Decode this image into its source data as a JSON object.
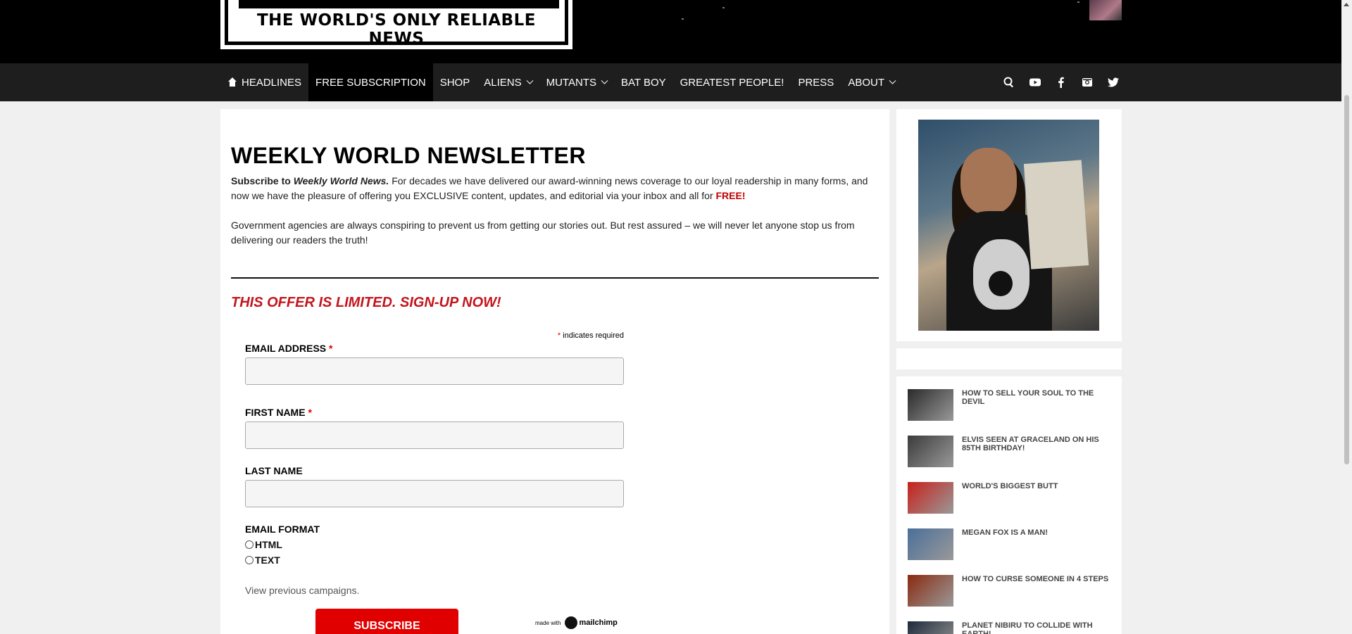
{
  "header": {
    "logo_tagline": "THE WORLD'S ONLY RELIABLE NEWS"
  },
  "nav": {
    "items": [
      {
        "label": "HEADLINES",
        "active": false
      },
      {
        "label": "FREE SUBSCRIPTION",
        "active": true
      },
      {
        "label": "SHOP",
        "active": false
      },
      {
        "label": "ALIENS",
        "active": false
      },
      {
        "label": "MUTANTS",
        "active": false
      },
      {
        "label": "BAT BOY",
        "active": false
      },
      {
        "label": "GREATEST PEOPLE!",
        "active": false
      },
      {
        "label": "PRESS",
        "active": false
      },
      {
        "label": "ABOUT",
        "active": false
      }
    ],
    "icons": [
      "search-icon",
      "youtube-icon",
      "facebook-icon",
      "instagram-icon",
      "twitter-icon"
    ]
  },
  "main": {
    "title": "WEEKLY WORLD NEWSLETTER",
    "intro1_lead": "Subscribe to ",
    "intro1_pub": "Weekly World News.",
    "intro1_body": " For decades we have delivered our award-winning news coverage to our loyal readership in many forms, and now we have the pleasure of offering you EXCLUSIVE content, updates, and editorial via your inbox and all for ",
    "intro1_free": "FREE!",
    "intro2": "Government agencies are always conspiring to prevent us from getting our stories out. But rest assured – we will never let anyone stop us from delivering our readers the truth!",
    "offer": "THIS OFFER IS LIMITED. SIGN-UP NOW!"
  },
  "form": {
    "required_mark": "*",
    "required_note": " indicates required",
    "email_label": "EMAIL ADDRESS ",
    "first_label": "FIRST NAME ",
    "last_label": "LAST NAME",
    "format_label": "EMAIL FORMAT",
    "format_options": [
      "HTML",
      "TEXT"
    ],
    "previous": "View previous campaigns.",
    "subscribe": "SUBSCRIBE",
    "made_with": "made with",
    "mailchimp": "mailchimp"
  },
  "sidebar": {
    "headlines": [
      {
        "title": "HOW TO SELL YOUR SOUL TO THE DEVIL",
        "thumb_color": "#2a2a2a"
      },
      {
        "title": "ELVIS SEEN AT GRACELAND ON HIS 85th BIRTHDAY!",
        "thumb_color": "#3b3b3b"
      },
      {
        "title": "WORLD'S BIGGEST BUTT",
        "thumb_color": "#c8201a"
      },
      {
        "title": "MEGAN FOX IS A MAN!",
        "thumb_color": "#4a6f9a"
      },
      {
        "title": "HOW TO CURSE SOMEONE IN 4 STEPS",
        "thumb_color": "#8a2a10"
      },
      {
        "title": "PLANET NIBIRU TO COLLIDE WITH EARTH!",
        "thumb_color": "#1e2a3a"
      }
    ]
  },
  "colors": {
    "accent_red": "#c4141c",
    "nav_bg": "#1e1e1e"
  }
}
